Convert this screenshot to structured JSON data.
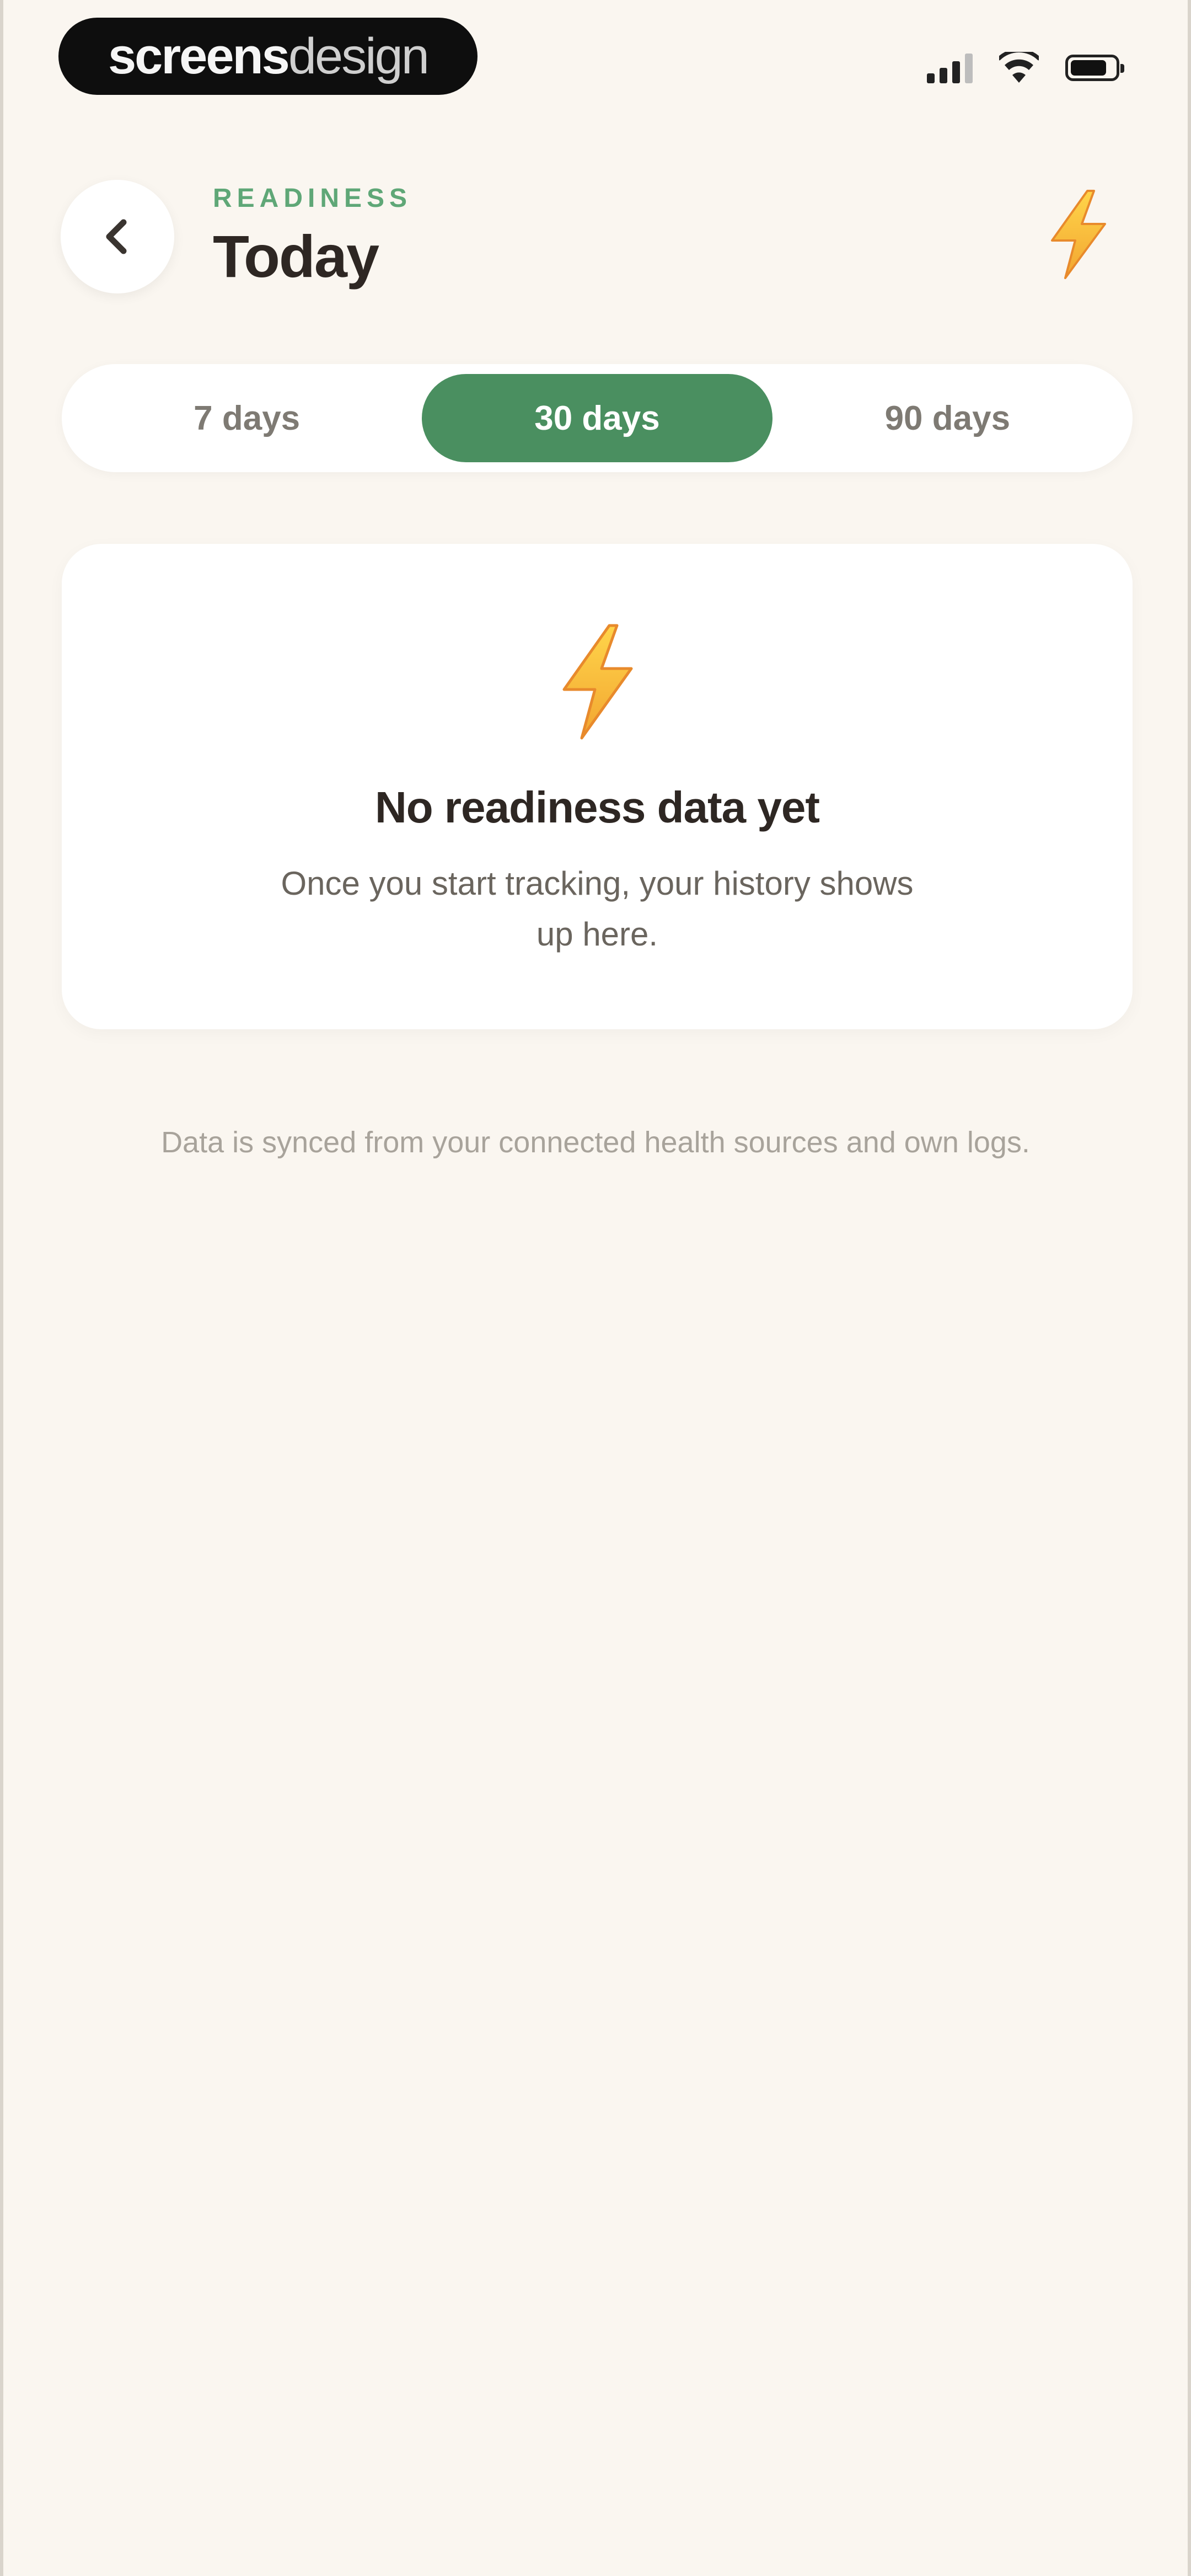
{
  "status_bar": {
    "brand_bold": "screens",
    "brand_light": "design",
    "icons": [
      "cellular-signal-icon",
      "wifi-icon",
      "battery-icon"
    ]
  },
  "header": {
    "eyebrow": "READINESS",
    "title": "Today",
    "back_icon": "chevron-left-icon",
    "action_icon": "lightning-bolt-icon"
  },
  "range_selector": {
    "options": [
      "7 days",
      "30 days",
      "90 days"
    ],
    "selected": "30 days"
  },
  "empty_state": {
    "icon": "lightning-bolt-icon",
    "title": "No readiness data yet",
    "message": "Once you start tracking, your history shows up here."
  },
  "footnote": "Data is synced from your connected health sources and own logs.",
  "colors": {
    "background": "#FAF6F0",
    "accent_green": "#4A8F60",
    "eyebrow_green": "#5FA777",
    "bolt_yellow": "#F6C445",
    "bolt_orange": "#E88A2C"
  }
}
